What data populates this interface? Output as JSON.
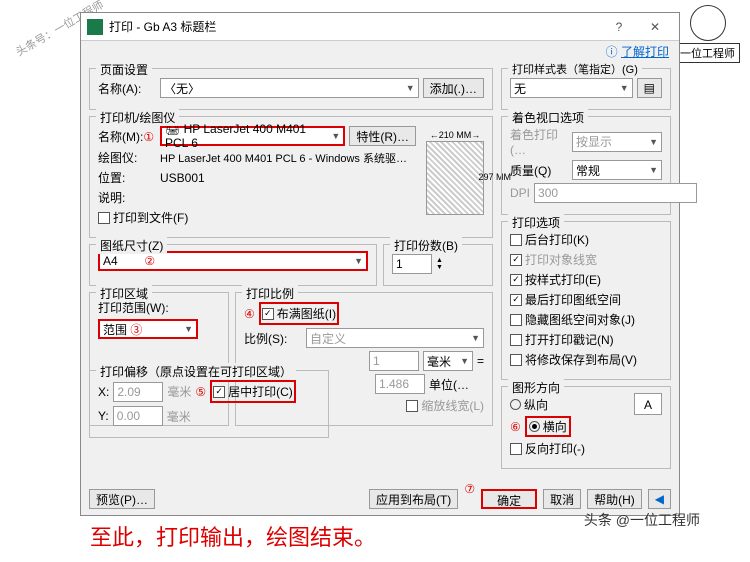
{
  "watermark_left": "头条号：一位工程师",
  "watermark_right": "一位工程师",
  "watermark_bottom": "头条 @一位工程师",
  "caption": "至此，打印输出，绘图结束。",
  "title": "打印 - Gb A3 标题栏",
  "learn_link": "了解打印",
  "page_setup": {
    "title": "页面设置",
    "name_label": "名称(A):",
    "name_value": "〈无〉",
    "add_btn": "添加(.)…"
  },
  "printer": {
    "title": "打印机/绘图仪",
    "name_label": "名称(M):",
    "name_value": "HP LaserJet 400 M401 PCL 6",
    "props_btn": "特性(R)…",
    "plotter_label": "绘图仪:",
    "plotter_value": "HP LaserJet 400 M401 PCL 6 - Windows 系统驱…",
    "loc_label": "位置:",
    "loc_value": "USB001",
    "desc_label": "说明:",
    "to_file": "打印到文件(F)",
    "preview_w": "←210 MM→",
    "preview_h": "297 MM"
  },
  "paper": {
    "title": "图纸尺寸(Z)",
    "value": "A4",
    "copies_label": "打印份数(B)",
    "copies_value": "1"
  },
  "area": {
    "title": "打印区域",
    "range_label": "打印范围(W):",
    "range_value": "范围"
  },
  "scale": {
    "title": "打印比例",
    "fit": "布满图纸(I)",
    "ratio_label": "比例(S):",
    "ratio_value": "自定义",
    "unit_val": "1",
    "unit_label": "毫米",
    "du_val": "1.486",
    "du_label": "单位(…",
    "sw": "缩放线宽(L)"
  },
  "offset": {
    "title": "打印偏移（原点设置在可打印区域）",
    "x_label": "X:",
    "x_value": "2.09",
    "y_label": "Y:",
    "y_value": "0.00",
    "unit": "毫米",
    "center": "居中打印(C)"
  },
  "styletable": {
    "title": "打印样式表（笔指定）(G)",
    "value": "无"
  },
  "viewport": {
    "title": "着色视口选项",
    "shade_label": "着色打印(…",
    "shade_value": "按显示",
    "quality_label": "质量(Q)",
    "quality_value": "常规",
    "dpi_label": "DPI",
    "dpi_value": "300"
  },
  "options": {
    "title": "打印选项",
    "items": [
      {
        "label": "后台打印(K)",
        "on": false,
        "dis": false
      },
      {
        "label": "打印对象线宽",
        "on": true,
        "dis": true
      },
      {
        "label": "按样式打印(E)",
        "on": true,
        "dis": false
      },
      {
        "label": "最后打印图纸空间",
        "on": true,
        "dis": false
      },
      {
        "label": "隐藏图纸空间对象(J)",
        "on": false,
        "dis": false
      },
      {
        "label": "打开打印戳记(N)",
        "on": false,
        "dis": false
      },
      {
        "label": "将修改保存到布局(V)",
        "on": false,
        "dis": false
      }
    ]
  },
  "orient": {
    "title": "图形方向",
    "portrait": "纵向",
    "landscape": "横向",
    "flip": "反向打印(-)"
  },
  "buttons": {
    "preview": "预览(P)…",
    "apply": "应用到布局(T)",
    "ok": "确定",
    "cancel": "取消",
    "help": "帮助(H)"
  },
  "circles": {
    "1": "①",
    "2": "②",
    "3": "③",
    "4": "④",
    "5": "⑤",
    "6": "⑥",
    "7": "⑦"
  }
}
